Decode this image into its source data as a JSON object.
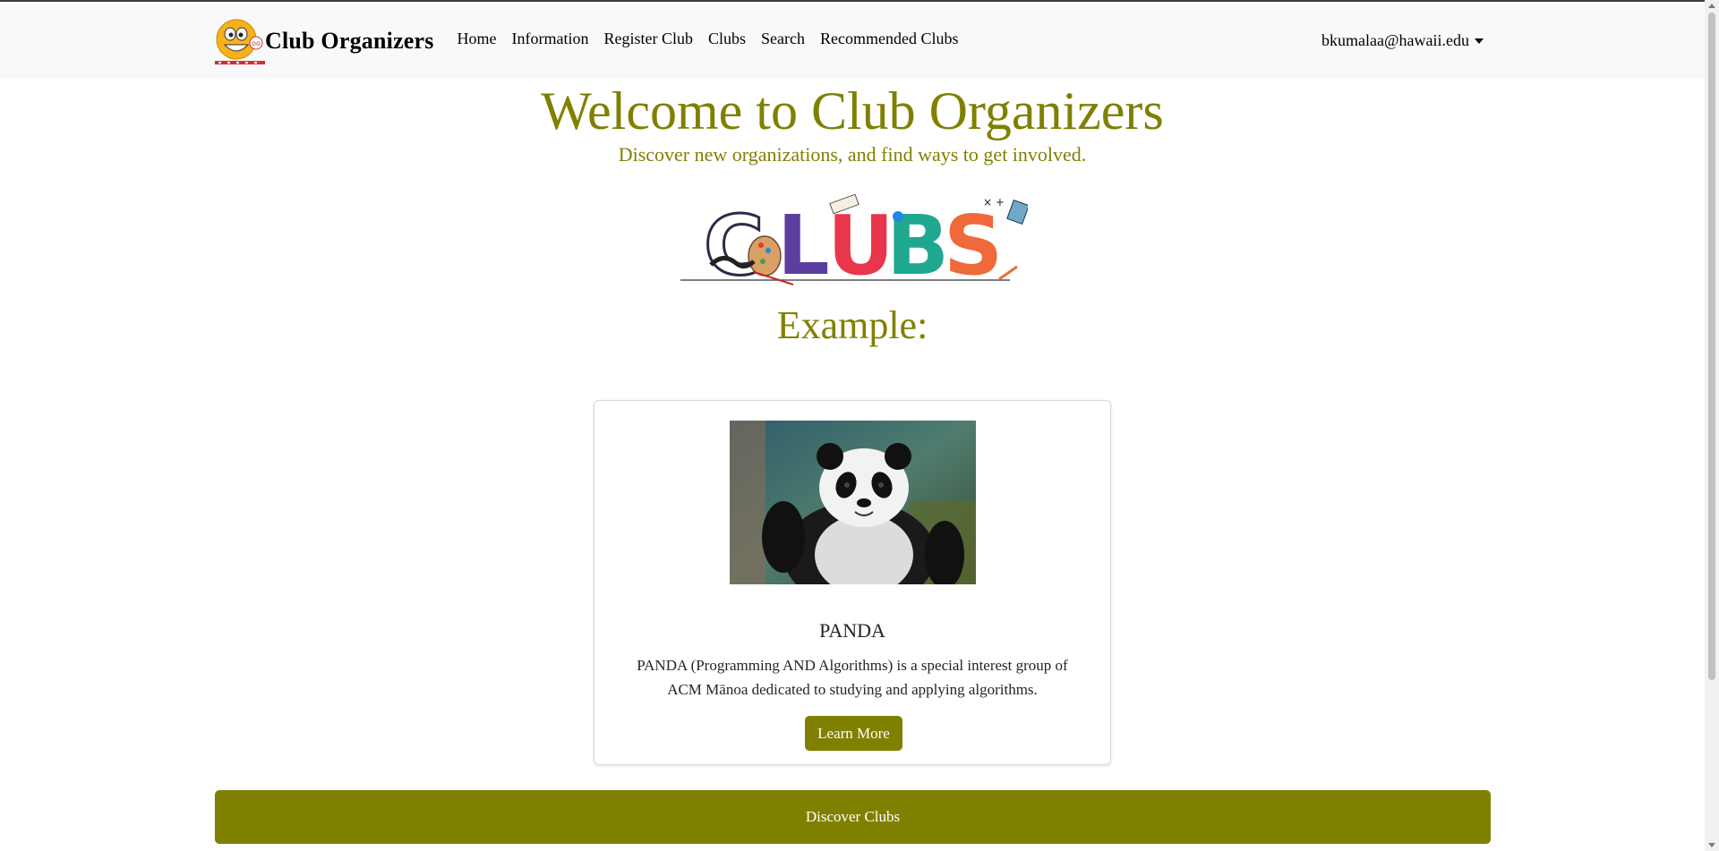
{
  "navbar": {
    "brand": "Club Organizers",
    "links": [
      "Home",
      "Information",
      "Register Club",
      "Clubs",
      "Search",
      "Recommended Clubs"
    ],
    "user_email": "bkumalaa@hawaii.edu"
  },
  "hero": {
    "title": "Welcome to Club Organizers",
    "subtitle": "Discover new organizations, and find ways to get involved.",
    "banner_text": "CLUBS",
    "example_heading": "Example:"
  },
  "example_card": {
    "title": "PANDA",
    "description": "PANDA (Programming AND Algorithms) is a special interest group of ACM Mānoa dedicated to studying and applying algorithms.",
    "button_label": "Learn More"
  },
  "discover_button": "Discover Clubs",
  "colors": {
    "accent": "#808000",
    "navbar_bg": "#f8f9fa"
  },
  "icons": [
    "smiley-logo-icon",
    "chevron-down-icon",
    "panda-image",
    "clubs-banner"
  ]
}
